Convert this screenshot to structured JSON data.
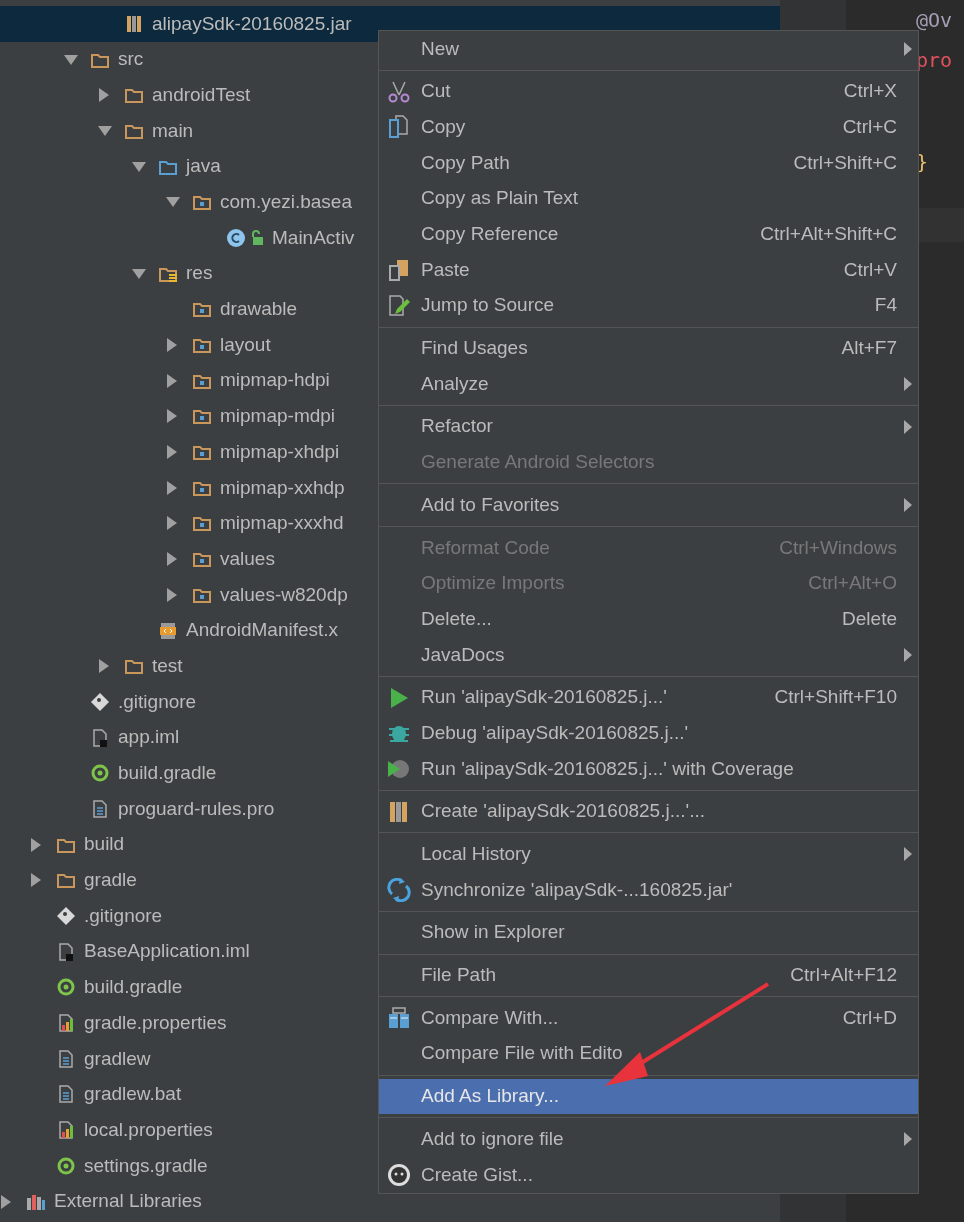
{
  "project_tree": [
    {
      "children": [
        {
          "children": [
            {
              "children": [
                {
                  "label": "alipaySdk-20160825.jar",
                  "kind": "jar",
                  "selected": true
                }
              ]
            },
            {
              "label": "src",
              "kind": "folder",
              "expanded": true,
              "selected": false,
              "children": [
                {
                  "label": "androidTest",
                  "kind": "folder",
                  "expanded": false,
                  "selected": false
                },
                {
                  "label": "main",
                  "kind": "folder",
                  "expanded": true,
                  "selected": false,
                  "children": [
                    {
                      "label": "java",
                      "kind": "source-folder",
                      "expanded": true,
                      "selected": false,
                      "children": [
                        {
                          "label": "com.yezi.basea",
                          "kind": "package",
                          "expanded": true,
                          "selected": false,
                          "children": [
                            {
                              "label": "MainActiv",
                              "kind": "class",
                              "selected": false
                            }
                          ]
                        }
                      ]
                    },
                    {
                      "label": "res",
                      "kind": "resource-folder",
                      "expanded": true,
                      "selected": false,
                      "children": [
                        {
                          "label": "drawable",
                          "kind": "package",
                          "selected": false
                        },
                        {
                          "label": "layout",
                          "kind": "package",
                          "expanded": false,
                          "selected": false
                        },
                        {
                          "label": "mipmap-hdpi",
                          "kind": "package",
                          "expanded": false,
                          "selected": false
                        },
                        {
                          "label": "mipmap-mdpi",
                          "kind": "package",
                          "expanded": false,
                          "selected": false
                        },
                        {
                          "label": "mipmap-xhdpi",
                          "kind": "package",
                          "expanded": false,
                          "selected": false
                        },
                        {
                          "label": "mipmap-xxhdp",
                          "kind": "package",
                          "expanded": false,
                          "selected": false
                        },
                        {
                          "label": "mipmap-xxxhd",
                          "kind": "package",
                          "expanded": false,
                          "selected": false
                        },
                        {
                          "label": "values",
                          "kind": "package",
                          "expanded": false,
                          "selected": false
                        },
                        {
                          "label": "values-w820dp",
                          "kind": "package",
                          "expanded": false,
                          "selected": false
                        }
                      ]
                    },
                    {
                      "label": "AndroidManifest.x",
                      "kind": "manifest",
                      "selected": false
                    }
                  ]
                },
                {
                  "label": "test",
                  "kind": "folder",
                  "expanded": false,
                  "selected": false
                }
              ]
            },
            {
              "label": ".gitignore",
              "kind": "git",
              "selected": false
            },
            {
              "label": "app.iml",
              "kind": "module-file",
              "selected": false
            },
            {
              "label": "build.gradle",
              "kind": "gradle",
              "selected": false
            },
            {
              "label": "proguard-rules.pro",
              "kind": "text-file",
              "selected": false
            }
          ]
        },
        {
          "label": "build",
          "kind": "folder",
          "expanded": false,
          "selected": false
        },
        {
          "label": "gradle",
          "kind": "folder",
          "expanded": false,
          "selected": false
        },
        {
          "label": ".gitignore",
          "kind": "git",
          "selected": false
        },
        {
          "label": "BaseApplication.iml",
          "kind": "module-file",
          "selected": false
        },
        {
          "label": "build.gradle",
          "kind": "gradle",
          "selected": false
        },
        {
          "label": "gradle.properties",
          "kind": "properties",
          "selected": false
        },
        {
          "label": "gradlew",
          "kind": "text-file",
          "selected": false
        },
        {
          "label": "gradlew.bat",
          "kind": "text-file",
          "selected": false
        },
        {
          "label": "local.properties",
          "kind": "properties",
          "selected": false
        },
        {
          "label": "settings.gradle",
          "kind": "gradle",
          "selected": false
        }
      ]
    },
    {
      "label": "External Libraries",
      "kind": "libraries",
      "expanded": false,
      "selected": false
    }
  ],
  "editor_fragments": [
    {
      "text": "@Ov",
      "kind": "annotation"
    },
    {
      "text": "pro",
      "kind": "keyword"
    },
    {
      "text": "}",
      "kind": "brace"
    }
  ],
  "context_menu": [
    {
      "kind": "plain",
      "label": "New",
      "submenu": true,
      "selected": false
    },
    {
      "kind": "separator"
    },
    {
      "kind": "cut",
      "label": "Cut",
      "shortcut": "Ctrl+X",
      "selected": false
    },
    {
      "kind": "copy",
      "label": "Copy",
      "shortcut": "Ctrl+C",
      "selected": false
    },
    {
      "kind": "plain",
      "label": "Copy Path",
      "shortcut": "Ctrl+Shift+C",
      "selected": false
    },
    {
      "kind": "plain",
      "label": "Copy as Plain Text",
      "selected": false
    },
    {
      "kind": "plain",
      "label": "Copy Reference",
      "shortcut": "Ctrl+Alt+Shift+C",
      "selected": false
    },
    {
      "kind": "paste",
      "label": "Paste",
      "shortcut": "Ctrl+V",
      "selected": false
    },
    {
      "kind": "edit",
      "label": "Jump to Source",
      "shortcut": "F4",
      "selected": false
    },
    {
      "kind": "separator"
    },
    {
      "kind": "plain",
      "label": "Find Usages",
      "shortcut": "Alt+F7",
      "selected": false
    },
    {
      "kind": "plain",
      "label": "Analyze",
      "submenu": true,
      "selected": false
    },
    {
      "kind": "separator"
    },
    {
      "kind": "plain",
      "label": "Refactor",
      "submenu": true,
      "selected": false
    },
    {
      "kind": "plain",
      "label": "Generate Android Selectors",
      "disabled": true,
      "selected": false
    },
    {
      "kind": "separator"
    },
    {
      "kind": "plain",
      "label": "Add to Favorites",
      "submenu": true,
      "selected": false
    },
    {
      "kind": "separator"
    },
    {
      "kind": "plain",
      "label": "Reformat Code",
      "shortcut": "Ctrl+Windows",
      "disabled": true,
      "selected": false
    },
    {
      "kind": "plain",
      "label": "Optimize Imports",
      "shortcut": "Ctrl+Alt+O",
      "disabled": true,
      "selected": false
    },
    {
      "kind": "plain",
      "label": "Delete...",
      "shortcut": "Delete",
      "selected": false
    },
    {
      "kind": "plain",
      "label": "JavaDocs",
      "submenu": true,
      "selected": false
    },
    {
      "kind": "separator"
    },
    {
      "kind": "run",
      "label": "Run 'alipaySdk-20160825.j...'",
      "shortcut": "Ctrl+Shift+F10",
      "selected": false
    },
    {
      "kind": "debug",
      "label": "Debug 'alipaySdk-20160825.j...'",
      "selected": false
    },
    {
      "kind": "coverage",
      "label": "Run 'alipaySdk-20160825.j...' with Coverage",
      "selected": false
    },
    {
      "kind": "separator"
    },
    {
      "kind": "jar",
      "label": "Create 'alipaySdk-20160825.j...'...",
      "selected": false
    },
    {
      "kind": "separator"
    },
    {
      "kind": "plain",
      "label": "Local History",
      "submenu": true,
      "selected": false
    },
    {
      "kind": "sync",
      "label": "Synchronize 'alipaySdk-...160825.jar'",
      "selected": false
    },
    {
      "kind": "separator"
    },
    {
      "kind": "plain",
      "label": "Show in Explorer",
      "selected": false
    },
    {
      "kind": "separator"
    },
    {
      "kind": "plain",
      "label": "File Path",
      "shortcut": "Ctrl+Alt+F12",
      "selected": false
    },
    {
      "kind": "separator"
    },
    {
      "kind": "compare",
      "label": "Compare With...",
      "shortcut": "Ctrl+D",
      "selected": false
    },
    {
      "kind": "plain",
      "label": "Compare File with Edito",
      "selected": false
    },
    {
      "kind": "separator"
    },
    {
      "kind": "plain",
      "label": "Add As Library...",
      "selected": true
    },
    {
      "kind": "separator"
    },
    {
      "kind": "plain",
      "label": "Add to ignore file",
      "submenu": true,
      "selected": false
    },
    {
      "kind": "gist",
      "label": "Create Gist...",
      "selected": false
    }
  ]
}
